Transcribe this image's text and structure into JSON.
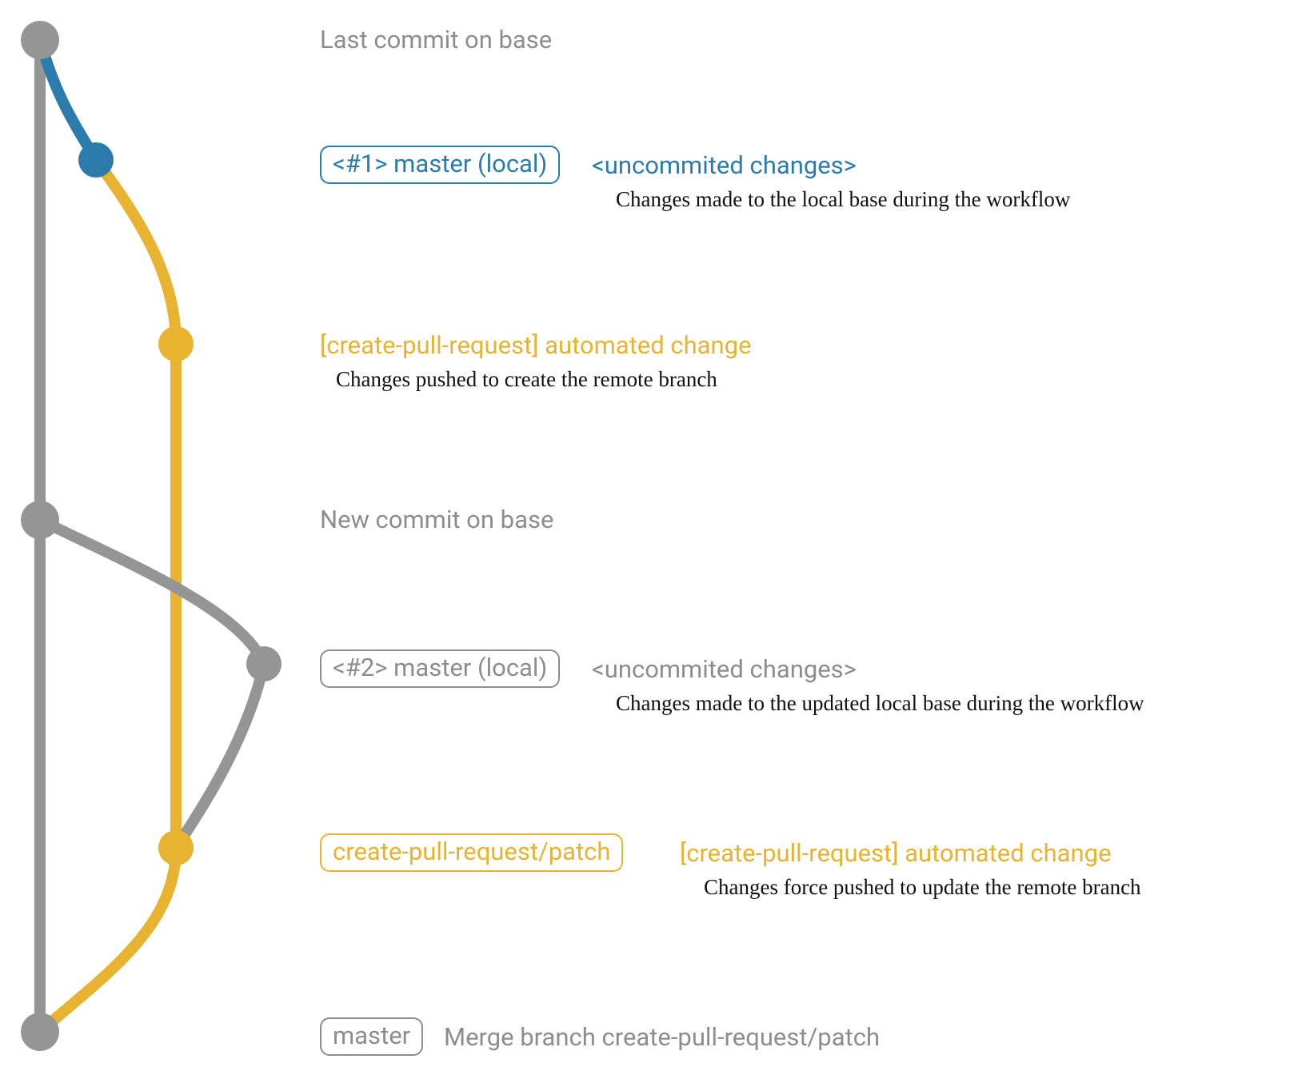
{
  "colors": {
    "gray": "#959595",
    "blue": "#2b7cac",
    "yellow": "#e7b330"
  },
  "rows": {
    "r1": {
      "title": "Last commit on base"
    },
    "r2": {
      "pill": "<#1> master (local)",
      "tag": "<uncommited changes>",
      "sub": "Changes made to the local base during the workflow"
    },
    "r3": {
      "title": "[create-pull-request] automated change",
      "sub": "Changes pushed to create the remote branch"
    },
    "r4": {
      "title": "New commit on base"
    },
    "r5": {
      "pill": "<#2> master (local)",
      "tag": "<uncommited changes>",
      "sub": "Changes made to the updated local base during the workflow"
    },
    "r6": {
      "pill": "create-pull-request/patch",
      "title": "[create-pull-request] automated change",
      "sub": "Changes force pushed to update the remote branch"
    },
    "r7": {
      "pill": "master",
      "title": "Merge branch create-pull-request/patch"
    }
  }
}
